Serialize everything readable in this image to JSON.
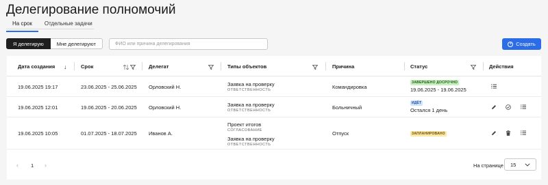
{
  "page": {
    "title": "Делегирование полномочий"
  },
  "tabs": [
    {
      "label": "На срок"
    },
    {
      "label": "Отдельные задачи"
    }
  ],
  "toggle": {
    "mine": "Я делегирую",
    "others": "Мне делегируют"
  },
  "search": {
    "placeholder": "ФИО или причина делегирования"
  },
  "create_button": {
    "label": "Создать"
  },
  "table": {
    "headers": {
      "created": "Дата создания",
      "term": "Срок",
      "delegate": "Делегат",
      "types": "Типы объектов",
      "reason": "Причина",
      "status": "Статус",
      "actions": "Действия"
    },
    "rows": [
      {
        "created": "19.06.2025 19:17",
        "term": "23.06.2025 - 25.06.2025",
        "delegate": "Орловский Н.",
        "types": [
          {
            "name": "Заявка на проверку",
            "sub": "ОТВЕТСТВЕННОСТЬ"
          }
        ],
        "reason": "Командировка",
        "status_badge": "ЗАВЕРШЕНО ДОСРОЧНО",
        "status_text": "19.06.2025 - 19.06.2025"
      },
      {
        "created": "19.06.2025 12:01",
        "term": "19.06.2025 - 20.06.2025",
        "delegate": "Орловский Н.",
        "types": [
          {
            "name": "Заявка на проверку",
            "sub": "ОТВЕТСТВЕННОСТЬ"
          }
        ],
        "reason": "Больничный",
        "status_badge": "ИДЁТ",
        "status_text": "Остался 1 день"
      },
      {
        "created": "19.06.2025 10:05",
        "term": "01.07.2025 - 18.07.2025",
        "delegate": "Иванов А.",
        "types": [
          {
            "name": "Проект итогов",
            "sub": "СОГЛАСОВАНИЕ"
          },
          {
            "name": "Заявка на проверку",
            "sub": "ОТВЕТСТВЕННОСТЬ"
          }
        ],
        "reason": "Отпуск",
        "status_badge": "ЗАПЛАНИРОВАНО",
        "status_text": ""
      }
    ]
  },
  "pagination": {
    "current_page": "1",
    "per_page_label": "На странице",
    "per_page_value": "15"
  },
  "colors": {
    "accent": "#2b6de8",
    "badge_green": "#c7efbf",
    "badge_blue": "#cfe3fb",
    "badge_yellow": "#fbe8a6"
  }
}
